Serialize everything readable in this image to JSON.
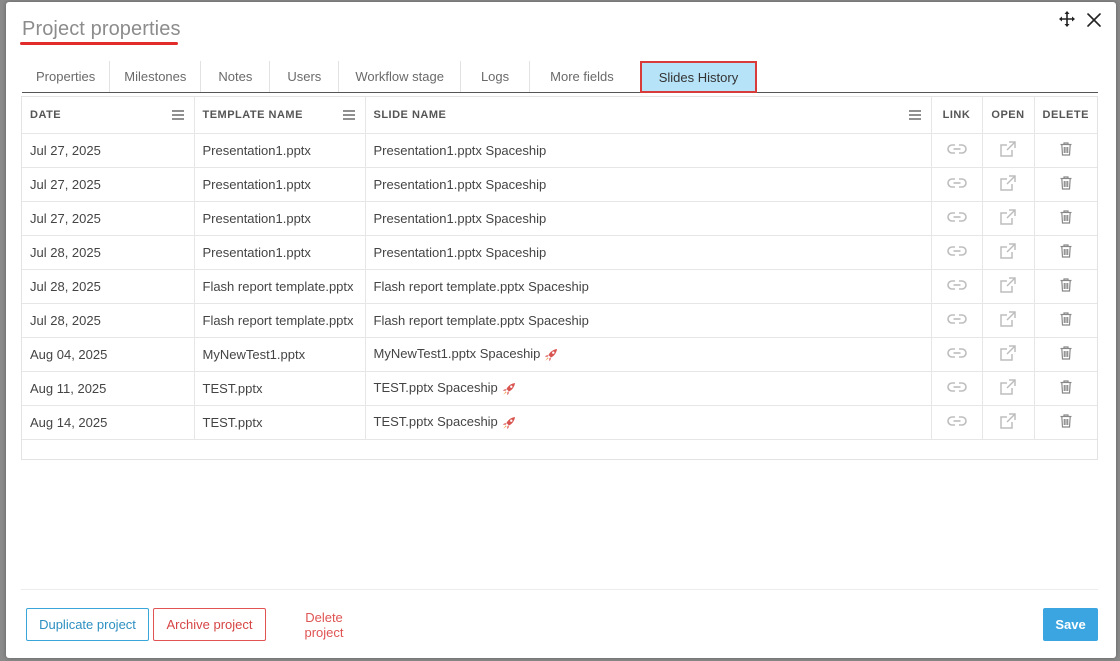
{
  "dialog": {
    "title": "Project properties"
  },
  "tabs": [
    {
      "label": "Properties",
      "active": false
    },
    {
      "label": "Milestones",
      "active": false
    },
    {
      "label": "Notes",
      "active": false
    },
    {
      "label": "Users",
      "active": false
    },
    {
      "label": "Workflow stage",
      "active": false
    },
    {
      "label": "Logs",
      "active": false
    },
    {
      "label": "More fields",
      "active": false
    },
    {
      "label": "Slides History",
      "active": true
    }
  ],
  "table": {
    "headers": {
      "date": "DATE",
      "template": "TEMPLATE NAME",
      "slide": "SLIDE NAME",
      "link": "LINK",
      "open": "OPEN",
      "delete": "DELETE"
    },
    "rows": [
      {
        "date": "Jul 27, 2025",
        "template": "Presentation1.pptx",
        "slide": "Presentation1.pptx Spaceship",
        "rocket": false
      },
      {
        "date": "Jul 27, 2025",
        "template": "Presentation1.pptx",
        "slide": "Presentation1.pptx Spaceship",
        "rocket": false
      },
      {
        "date": "Jul 27, 2025",
        "template": "Presentation1.pptx",
        "slide": "Presentation1.pptx Spaceship",
        "rocket": false
      },
      {
        "date": "Jul 28, 2025",
        "template": "Presentation1.pptx",
        "slide": "Presentation1.pptx Spaceship",
        "rocket": false
      },
      {
        "date": "Jul 28, 2025",
        "template": "Flash report template.pptx",
        "slide": "Flash report template.pptx Spaceship",
        "rocket": false
      },
      {
        "date": "Jul 28, 2025",
        "template": "Flash report template.pptx",
        "slide": "Flash report template.pptx Spaceship",
        "rocket": false
      },
      {
        "date": "Aug 04, 2025",
        "template": "MyNewTest1.pptx",
        "slide": "MyNewTest1.pptx Spaceship",
        "rocket": true
      },
      {
        "date": "Aug 11, 2025",
        "template": "TEST.pptx",
        "slide": "TEST.pptx Spaceship",
        "rocket": true
      },
      {
        "date": "Aug 14, 2025",
        "template": "TEST.pptx",
        "slide": "TEST.pptx Spaceship",
        "rocket": true
      }
    ]
  },
  "footer": {
    "duplicate_label": "Duplicate project",
    "archive_label": "Archive project",
    "delete_label": "Delete project",
    "save_label": "Save"
  },
  "icons": {
    "move": "move-icon",
    "close": "close-icon",
    "column_menu": "menu-icon",
    "link": "link-icon",
    "open": "external-link-icon",
    "delete": "trash-icon",
    "rocket": "rocket-icon"
  },
  "colors": {
    "active_tab_bg": "#b6e3f7",
    "highlight_red": "#d93b3b",
    "primary_blue": "#3aa5e0",
    "danger_red": "#e05454"
  }
}
